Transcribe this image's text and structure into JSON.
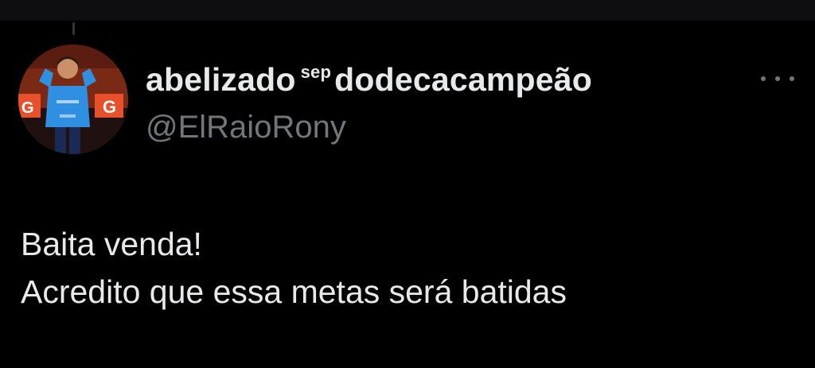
{
  "tweet": {
    "display_name_part1": "abelizado",
    "display_name_sup": "sep",
    "display_name_part2": "dodecacampeão",
    "handle": "@ElRaioRony",
    "text_lines": [
      "Baita venda!",
      "Acredito que essa metas será batidas"
    ]
  },
  "avatar_letters": {
    "left_badge": "G",
    "right_badge": "G"
  },
  "icons": {
    "more": "more-horizontal-icon"
  },
  "colors": {
    "background": "#000000",
    "text_primary": "#e7e9ea",
    "text_secondary": "#71767b",
    "badge_orange": "#e8502b",
    "jersey_blue": "#2f8fe0"
  }
}
